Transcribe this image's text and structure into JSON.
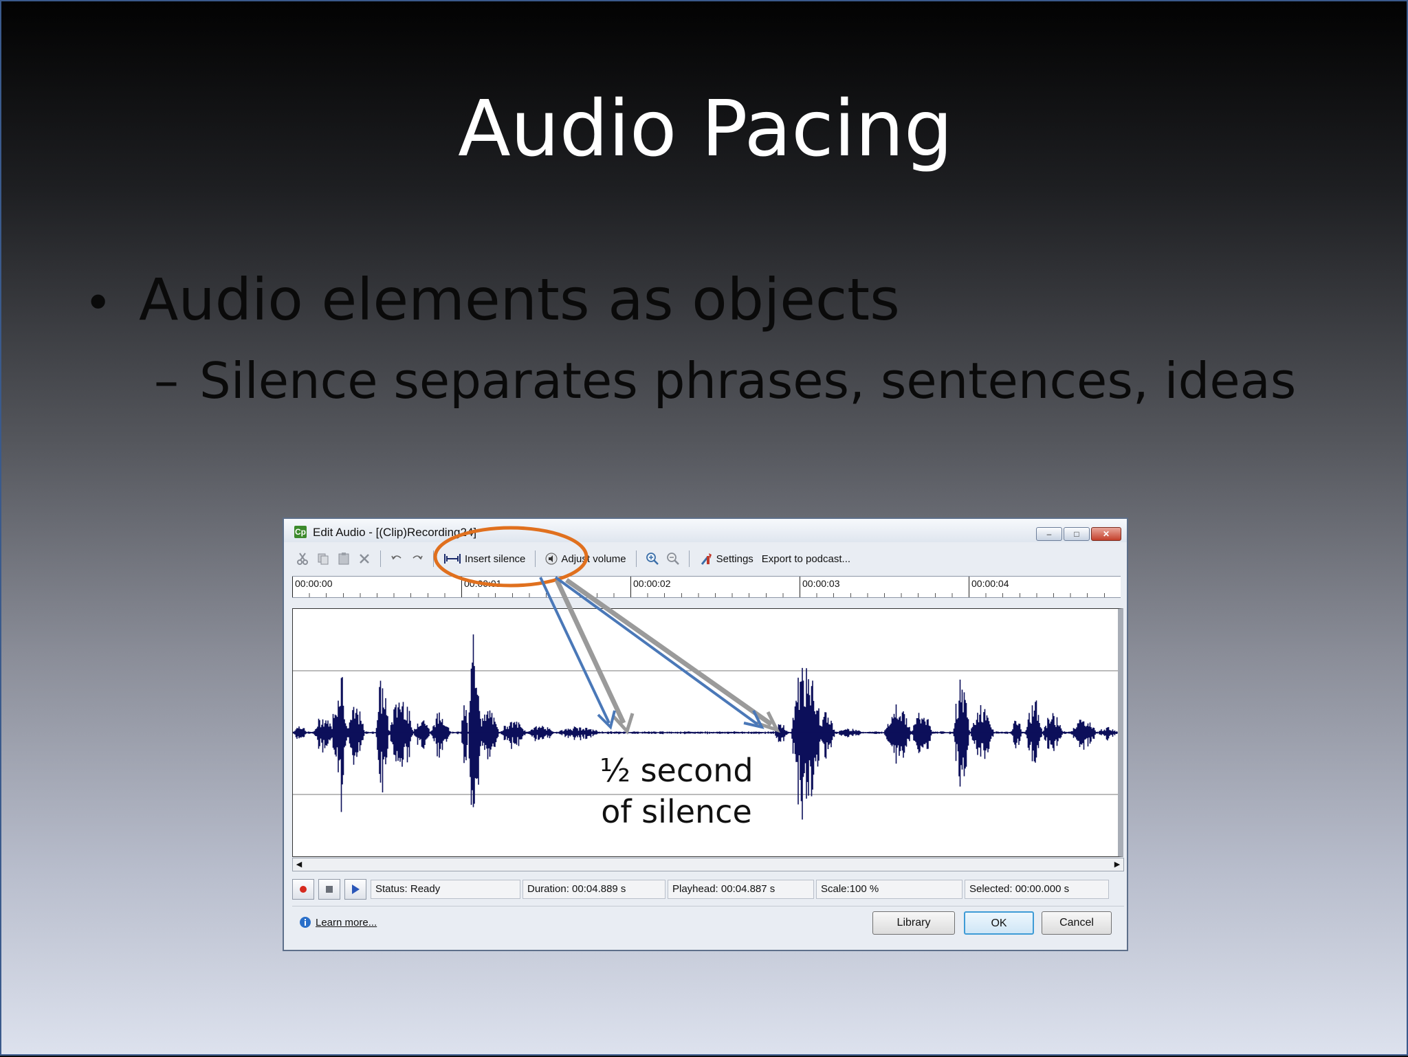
{
  "slide": {
    "title": "Audio Pacing",
    "bullet1": "Audio elements as objects",
    "bullet2_mark": "–",
    "bullet2": "Silence separates phrases, sentences, ideas",
    "bullet_mark": "•"
  },
  "dialog": {
    "app_icon": "Cp",
    "title": "Edit Audio - [(Clip)Recording24]",
    "window_buttons": {
      "minimize": "–",
      "maximize": "□",
      "close": "✕"
    },
    "toolbar": {
      "icons": [
        "cut-icon",
        "copy-icon",
        "paste-icon",
        "delete-icon",
        "undo-icon",
        "redo-icon"
      ],
      "insert_silence": "Insert silence",
      "adjust_volume": "Adjust volume",
      "zoom_icons": [
        "zoom-in-icon",
        "zoom-out-icon"
      ],
      "settings": "Settings",
      "export": "Export to podcast..."
    },
    "ruler": [
      "00:00:00",
      "00:00:01",
      "00:00:02",
      "00:00:03",
      "00:00:04"
    ],
    "status": {
      "status": "Status: Ready",
      "duration": "Duration: 00:04.889 s",
      "playhead": "Playhead: 00:04.887 s",
      "scale": "Scale:100 %",
      "selected": "Selected: 00:00.000 s"
    },
    "learn_more": "Learn more...",
    "buttons": {
      "library": "Library",
      "ok": "OK",
      "cancel": "Cancel"
    }
  },
  "annotation": {
    "line1": "½ second",
    "line2": "of silence",
    "circle_color": "#e0701e",
    "arrow_color": "#4a78b8"
  },
  "colors": {
    "waveform": "#0c0f5a",
    "title": "#ffffff"
  }
}
